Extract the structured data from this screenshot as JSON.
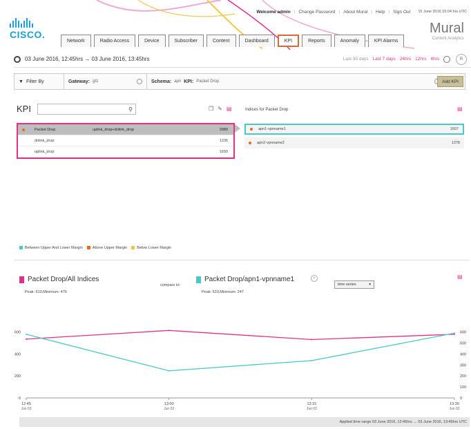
{
  "header": {
    "top_links": {
      "welcome": "Welcome admin",
      "change_password": "Change Password",
      "about": "About Mural",
      "help": "Help",
      "sign_out": "Sign Out",
      "timestamp": "15 June 2016 15:04 hrs UTC"
    },
    "logo_text": "CISCO.",
    "product_name": "Mural",
    "product_sub": "Content Analytics",
    "tabs": [
      {
        "label": "Network",
        "active": false
      },
      {
        "label": "Radio Access",
        "active": false
      },
      {
        "label": "Device",
        "active": false
      },
      {
        "label": "Subscriber",
        "active": false
      },
      {
        "label": "Content",
        "active": false
      },
      {
        "label": "Dashboard",
        "active": false
      },
      {
        "label": "KPI",
        "active": true
      },
      {
        "label": "Reports",
        "active": false
      },
      {
        "label": "Anomaly",
        "active": false
      },
      {
        "label": "KPI Alarms",
        "active": false
      }
    ]
  },
  "datebar": {
    "range": "03 June 2016, 12:45hrs → 03 June 2016, 13:45hrs",
    "quick": {
      "last30": "Last 30 days",
      "last7": "Last 7 days",
      "h24": "24hrs",
      "h12": "12hrs",
      "h4": "4hrs"
    },
    "refresh": "R"
  },
  "filter": {
    "filter_by": "Filter By",
    "gateway_label": "Gateway:",
    "gateway_value": "gt1",
    "schema_label": "Schema:",
    "schema_value": "apn",
    "kpi_label": "KPI:",
    "kpi_value": "Packet Drop",
    "add_kpi": "Add KPI"
  },
  "kpi_panel": {
    "title": "KPI",
    "search_placeholder": "",
    "rows": [
      {
        "name": "Packet Drop",
        "formula": "uplink_drop+dnlink_drop",
        "value": "2980",
        "selected": true
      },
      {
        "name": "dnlink_drop",
        "formula": "",
        "value": "1335",
        "selected": false
      },
      {
        "name": "uplink_drop",
        "formula": "",
        "value": "1650",
        "selected": false
      }
    ]
  },
  "indices_panel": {
    "title": "Indices for Packet Drop",
    "rows": [
      {
        "name": "apn1-vpnname1",
        "value": "1607",
        "selected": true
      },
      {
        "name": "apn2-vpnname2",
        "value": "1378",
        "selected": false
      }
    ]
  },
  "legend": {
    "between": "Between Upper And Lower Margin",
    "above": "Above Upper Margin",
    "below": "Below Lower Margin",
    "colors": {
      "between": "#48c8c8",
      "above": "#e86a1e",
      "below": "#f5c242"
    }
  },
  "chart_header": {
    "left_title": "Packet Drop/All Indices",
    "left_peak": "Peak: 610,Minimum: 476",
    "compare_to": "compare to:",
    "right_title": "Packet Drop/apn1-vpnname1",
    "right_peak": "Peak: 533,Minimum: 247",
    "close": "×",
    "view_select": "time series",
    "view_chevron": "▾"
  },
  "chart_data": {
    "type": "line",
    "x": [
      "12:45",
      "13:00",
      "13:15",
      "13:30"
    ],
    "x_sublabels": [
      "Jun 03",
      "Jun 03",
      "Jun 03",
      "Jun 03"
    ],
    "series": [
      {
        "name": "Packet Drop/All Indices",
        "color": "#e2308a",
        "values": [
          536,
          615,
          532,
          580
        ]
      },
      {
        "name": "Packet Drop/apn1-vpnname1",
        "color": "#48c8c8",
        "values": [
          580,
          247,
          340,
          590
        ]
      }
    ],
    "left_axis": {
      "ticks": [
        0,
        200,
        400,
        600
      ],
      "ylim": [
        0,
        680
      ]
    },
    "right_axis": {
      "ticks": [
        0,
        100,
        200,
        300,
        400,
        500,
        600
      ],
      "ylim": [
        0,
        680
      ]
    }
  },
  "footer": {
    "applied": "Applied time range 03 June 2016, 12:45hrs → 03 June 2016, 13:45hrs UTC"
  }
}
